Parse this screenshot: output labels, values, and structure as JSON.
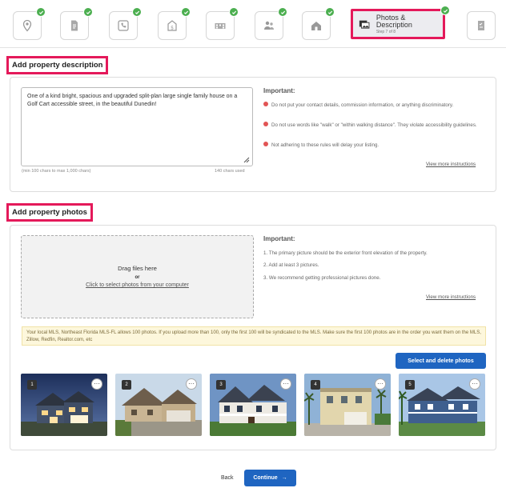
{
  "stepper": {
    "active": {
      "title": "Photos & Description",
      "subtitle": "Step 7 of 8"
    },
    "steps": [
      {
        "icon": "location-pin-icon"
      },
      {
        "icon": "document-icon"
      },
      {
        "icon": "phone-icon"
      },
      {
        "icon": "price-tag-icon"
      },
      {
        "icon": "building-icon"
      },
      {
        "icon": "people-icon"
      },
      {
        "icon": "house-hand-icon"
      },
      {
        "icon": "photos-icon"
      },
      {
        "icon": "checklist-icon"
      }
    ]
  },
  "description_section": {
    "title": "Add property description",
    "text": "One of a kind bright, spacious and upgraded split-plan large single family house on a Golf Cart accessible street, in the beautiful Dunedin!",
    "limit_hint": "(min 100 chars to max 1,000 chars)",
    "chars_used": "140 chars used",
    "important_title": "Important:",
    "rules": [
      "Do not put your contact details, commission information, or anything discriminatory.",
      "Do not use words like \"walk\" or \"within walking distance\". They violate accessibility guidelines.",
      "Not adhering to these rules will delay your listing."
    ],
    "view_more": "View more instructions"
  },
  "photos_section": {
    "title": "Add property photos",
    "drag_text": "Drag files here",
    "or_text": "or",
    "select_link": "Click to select photos from your computer",
    "important_title": "Important:",
    "rules": [
      "1. The primary picture should be the exterior front elevation of the property.",
      "2. Add at least 3 pictures.",
      "3. We recommend getting professional pictures done."
    ],
    "view_more": "View more instructions",
    "notice": "Your local MLS, Northeast Florida MLS-FL allows 100 photos. If you upload more than 100, only the first 100 will be syndicated to the MLS. Make sure the first 100 photos are in the order you want them on the MLS, Zillow, Redfin, Realtor.com, etc",
    "select_delete_label": "Select and delete photos",
    "photos": [
      {
        "number": "1",
        "description": "blue house at dusk"
      },
      {
        "number": "2",
        "description": "beige stone house"
      },
      {
        "number": "3",
        "description": "victorian house with porch"
      },
      {
        "number": "4",
        "description": "yellow house with palms"
      },
      {
        "number": "5",
        "description": "blue house with palms"
      }
    ],
    "more_glyph": "···"
  },
  "footer": {
    "back_label": "Back",
    "continue_label": "Continue",
    "continue_arrow": "→"
  },
  "colors": {
    "highlight": "#e4195a",
    "check": "#4caf50",
    "primary": "#1f65c1",
    "notice_bg": "#fdf7dc"
  }
}
